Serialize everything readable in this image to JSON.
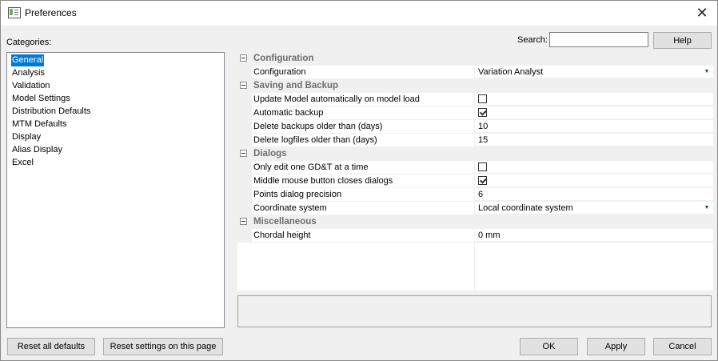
{
  "window": {
    "title": "Preferences",
    "close_glyph": "✕"
  },
  "categories": {
    "label": "Categories:",
    "items": [
      "General",
      "Analysis",
      "Validation",
      "Model Settings",
      "Distribution Defaults",
      "MTM Defaults",
      "Display",
      "Alias Display",
      "Excel"
    ],
    "selected": "General"
  },
  "search": {
    "label": "Search:",
    "value": "",
    "placeholder": ""
  },
  "buttons": {
    "help": "Help",
    "reset_all": "Reset all defaults",
    "reset_page": "Reset settings on this page",
    "ok": "OK",
    "apply": "Apply",
    "cancel": "Cancel"
  },
  "grid": {
    "sections": [
      {
        "title": "Configuration",
        "rows": [
          {
            "name": "Configuration",
            "value": "Variation Analyst",
            "type": "dropdown"
          }
        ]
      },
      {
        "title": "Saving and Backup",
        "rows": [
          {
            "name": "Update Model automatically on model load",
            "checked": false,
            "type": "checkbox"
          },
          {
            "name": "Automatic backup",
            "checked": true,
            "type": "checkbox"
          },
          {
            "name": "Delete backups older than (days)",
            "value": "10",
            "type": "text"
          },
          {
            "name": "Delete logfiles older than (days)",
            "value": "15",
            "type": "text"
          }
        ]
      },
      {
        "title": "Dialogs",
        "rows": [
          {
            "name": "Only edit one GD&T at a time",
            "checked": false,
            "type": "checkbox"
          },
          {
            "name": "Middle mouse button closes dialogs",
            "checked": true,
            "type": "checkbox"
          },
          {
            "name": "Points dialog precision",
            "value": "6",
            "type": "text"
          },
          {
            "name": "Coordinate system",
            "value": "Local coordinate system",
            "type": "dropdown"
          }
        ]
      },
      {
        "title": "Miscellaneous",
        "rows": [
          {
            "name": "Chordal height",
            "value": "0 mm",
            "type": "text"
          }
        ]
      }
    ]
  },
  "colors": {
    "selection": "#0078d7",
    "section_text": "#6d6d6d",
    "background": "#f0f0f0"
  }
}
